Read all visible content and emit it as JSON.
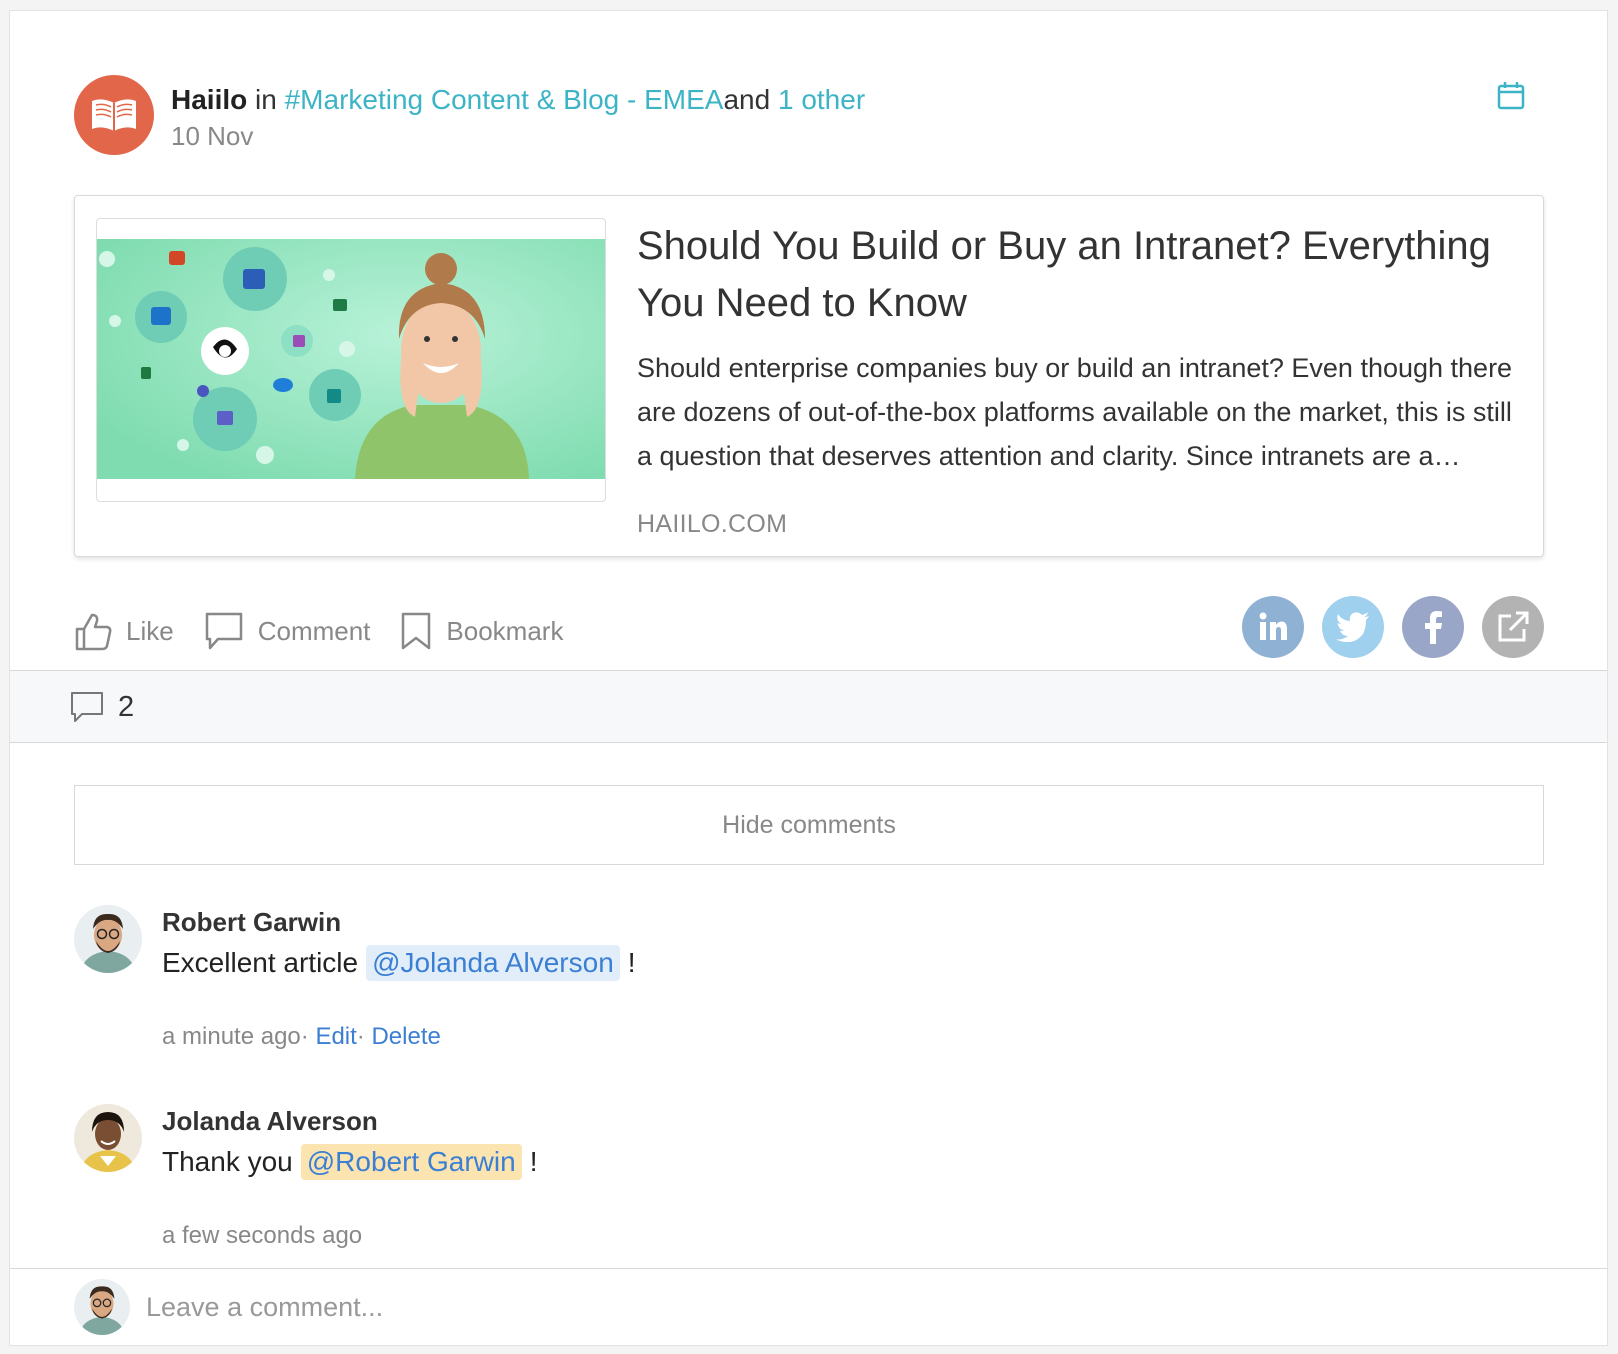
{
  "post": {
    "author": "Haiilo",
    "in_word": "in",
    "channel": "#Marketing Content & Blog - EMEA",
    "and_word": "and",
    "others": "1 other",
    "date": "10 Nov"
  },
  "preview": {
    "title": "Should You Build or Buy an Intranet? Everything You Need to Know",
    "description": "Should enterprise companies buy or build an intranet? Even though there are dozens of out-of-the-box platforms available on the market, this is still a question that deserves attention and clarity. Since intranets are a significant investment, you should weigh up the options carefully.",
    "domain": "HAIILO.COM"
  },
  "actions": {
    "like": "Like",
    "comment": "Comment",
    "bookmark": "Bookmark"
  },
  "share": {
    "linkedin_color": "#8fb1d3",
    "twitter_color": "#9fd0ee",
    "facebook_color": "#99a6c8",
    "external_color": "#b3b3b3"
  },
  "comment_count": "2",
  "hide_comments_label": "Hide comments",
  "comments": [
    {
      "author": "Robert Garwin",
      "text_before": "Excellent article",
      "mention": "@Jolanda Alverson",
      "text_after": "!",
      "time": "a minute ago",
      "sep": "·",
      "edit": "Edit",
      "delete": "Delete"
    },
    {
      "author": "Jolanda Alverson",
      "text_before": "Thank you",
      "mention": "@Robert Garwin",
      "text_after": "!",
      "time": "a few seconds ago"
    }
  ],
  "new_comment": {
    "placeholder": "Leave a comment..."
  },
  "colors": {
    "accent_teal": "#3cb4c6",
    "link_blue": "#3b7fd4",
    "avatar_orange": "#e2674a"
  }
}
